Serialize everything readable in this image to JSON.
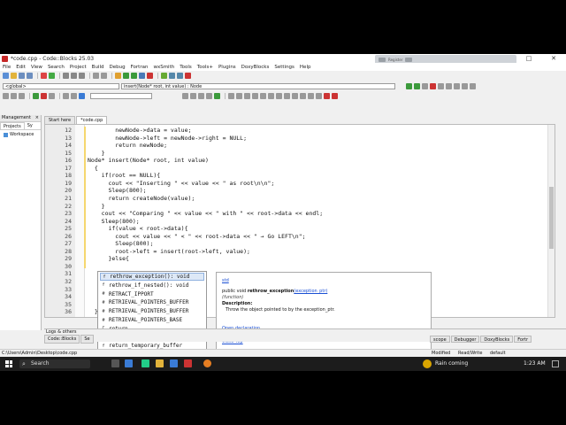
{
  "window": {
    "title": "*code.cpp - Code::Blocks 25.03",
    "controls": [
      "—",
      "□",
      "✕"
    ],
    "overlay_text": "Register"
  },
  "menu": [
    "File",
    "Edit",
    "View",
    "Search",
    "Project",
    "Build",
    "Debug",
    "Fortran",
    "wxSmith",
    "Tools",
    "Tools+",
    "Plugins",
    "DoxyBlocks",
    "Settings",
    "Help"
  ],
  "toolbar": {
    "scope": "<global>",
    "symbol": "insert(Node* root, int value) : Node"
  },
  "management": {
    "title": "Management",
    "close": "×",
    "tabs": [
      "Projects",
      "Sy"
    ],
    "workspace": "Workspace"
  },
  "editor": {
    "tabs": [
      "Start here",
      "*code.cpp"
    ],
    "lines": [
      {
        "num": "12",
        "text": "        newNode->data = value;"
      },
      {
        "num": "13",
        "text": "        newNode->left = newNode->right = NULL;"
      },
      {
        "num": "14",
        "text": "        return newNode;"
      },
      {
        "num": "15",
        "text": "    }"
      },
      {
        "num": "16",
        "text": "Node* insert(Node* root, int value)"
      },
      {
        "num": "17",
        "text": "  {"
      },
      {
        "num": "18",
        "text": "    if(root == NULL){"
      },
      {
        "num": "19",
        "text": "      cout << \"Inserting \" << value << \" as root\\n\\n\";"
      },
      {
        "num": "20",
        "text": "      Sleep(800);"
      },
      {
        "num": "21",
        "text": "      return createNode(value);"
      },
      {
        "num": "22",
        "text": "    }"
      },
      {
        "num": "23",
        "text": "    cout << \"Comparing \" << value << \" with \" << root->data << endl;"
      },
      {
        "num": "24",
        "text": "    Sleep(800);"
      },
      {
        "num": "25",
        "text": "      if(value < root->data){"
      },
      {
        "num": "26",
        "text": "        cout << value << \" < \" << root->data << \" → Go LEFT\\n\";"
      },
      {
        "num": "27",
        "text": "        Sleep(800);"
      },
      {
        "num": "28",
        "text": "        root->left = insert(root->left, value);"
      },
      {
        "num": "29",
        "text": "      }else{"
      },
      {
        "num": "30",
        "text": ""
      },
      {
        "num": "31",
        "text": ""
      },
      {
        "num": "32",
        "text": ""
      },
      {
        "num": "33",
        "text": ""
      },
      {
        "num": "34",
        "text": ""
      },
      {
        "num": "35",
        "text": ""
      },
      {
        "num": "36",
        "text": "  }"
      }
    ]
  },
  "autocomplete": {
    "items": [
      {
        "icon": "f",
        "label": "rethrow_exception(): void",
        "selected": true
      },
      {
        "icon": "f",
        "label": "rethrow_if_nested(): void",
        "selected": false
      },
      {
        "icon": "#",
        "label": "RETRACT_IPPORT",
        "selected": false
      },
      {
        "icon": "#",
        "label": "RETRIEVAL_POINTERS_BUFFER",
        "selected": false
      },
      {
        "icon": "#",
        "label": "RETRIEVAL_POINTERS_BUFFER",
        "selected": false
      },
      {
        "icon": "#",
        "label": "RETRIEVAL_POINTERS_BASE",
        "selected": false
      },
      {
        "icon": "C",
        "label": "return",
        "selected": false
      },
      {
        "icon": "#",
        "label": "RETURN_SMART_STATUS",
        "selected": false
      },
      {
        "icon": "f",
        "label": "return_temporary_buffer",
        "selected": false
      }
    ]
  },
  "doc": {
    "namespace": "std",
    "signature_prefix": "public void ",
    "signature_name": "rethrow_exception",
    "signature_param": "(exception_ptr)",
    "kind": "(function)",
    "desc_label": "Description:",
    "desc": "Throw the object pointed to by the exception_ptr.",
    "open": "Open declaration",
    "close": "Close Top"
  },
  "logs": {
    "title": "Logs & others",
    "tabs": [
      "Code::Blocks",
      "Se"
    ],
    "right_tabs": [
      "scope",
      "Debugger",
      "DoxyBlocks",
      "Fortr"
    ]
  },
  "status": {
    "path": "C:\\Users\\Admin\\Desktop\\code.cpp",
    "modified": "Modified",
    "rw": "Read/Write",
    "profile": "default"
  },
  "taskbar": {
    "search": "Search",
    "weather": "Rain coming",
    "time": "1:23 AM"
  }
}
